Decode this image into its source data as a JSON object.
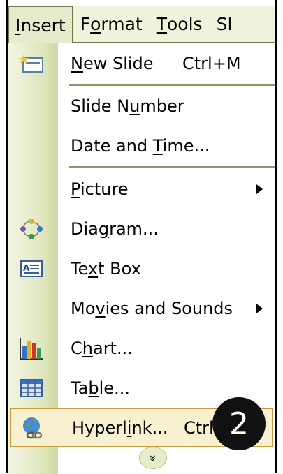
{
  "menubar": {
    "items": [
      {
        "pre": "",
        "u": "I",
        "post": "nsert"
      },
      {
        "pre": "F",
        "u": "o",
        "post": "rmat"
      },
      {
        "pre": "",
        "u": "T",
        "post": "ools"
      },
      {
        "pre": "Sl",
        "u": "",
        "post": ""
      }
    ]
  },
  "menu": {
    "new_slide": {
      "pre": "",
      "u": "N",
      "post": "ew Slide",
      "shortcut": "Ctrl+M",
      "icon": "new-slide-icon"
    },
    "slide_number": {
      "pre": "Slide N",
      "u": "u",
      "post": "mber"
    },
    "date_time": {
      "pre": "Date and ",
      "u": "T",
      "post": "ime..."
    },
    "picture": {
      "pre": "",
      "u": "P",
      "post": "icture"
    },
    "diagram": {
      "pre": "Dia",
      "u": "g",
      "post": "ram...",
      "icon": "diagram-icon"
    },
    "text_box": {
      "pre": "Te",
      "u": "x",
      "post": "t Box",
      "icon": "text-box-icon"
    },
    "movies": {
      "pre": "Mo",
      "u": "v",
      "post": "ies and Sounds"
    },
    "chart": {
      "pre": "C",
      "u": "h",
      "post": "art...",
      "icon": "chart-icon"
    },
    "table": {
      "pre": "Ta",
      "u": "b",
      "post": "le...",
      "icon": "table-icon"
    },
    "hyperlink": {
      "pre": "Hyperl",
      "u": "i",
      "post": "nk...",
      "shortcut": "Ctrl",
      "icon": "hyperlink-icon"
    }
  },
  "badge": "2",
  "expand_glyph": "»",
  "colors": {
    "gutter": "#dfe6bd",
    "highlight": "#f8f1cf",
    "highlight_border": "#c79a3c"
  }
}
